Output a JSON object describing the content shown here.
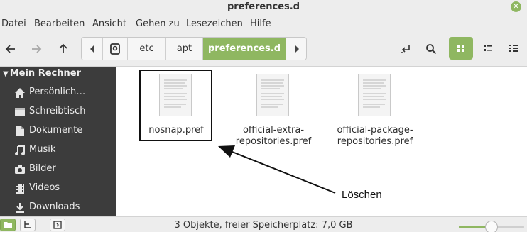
{
  "window": {
    "title": "preferences.d"
  },
  "menu": [
    "Datei",
    "Bearbeiten",
    "Ansicht",
    "Gehen zu",
    "Lesezeichen",
    "Hilfe"
  ],
  "toolbar": {
    "path": [
      "etc",
      "apt",
      "preferences.d"
    ],
    "active_path": "preferences.d"
  },
  "sidebar": {
    "header": "Mein Rechner",
    "items": [
      {
        "label": "Persönlich…",
        "icon": "home-icon"
      },
      {
        "label": "Schreibtisch",
        "icon": "desktop-folder-icon"
      },
      {
        "label": "Dokumente",
        "icon": "document-icon"
      },
      {
        "label": "Musik",
        "icon": "music-icon"
      },
      {
        "label": "Bilder",
        "icon": "camera-icon"
      },
      {
        "label": "Videos",
        "icon": "film-icon"
      },
      {
        "label": "Downloads",
        "icon": "download-icon"
      }
    ]
  },
  "files": [
    {
      "name_lines": [
        "nosnap.pref"
      ],
      "selected": true
    },
    {
      "name_lines": [
        "official-extra-",
        "repositories.pref"
      ],
      "selected": false
    },
    {
      "name_lines": [
        "official-package-",
        "repositories.pref"
      ],
      "selected": false
    }
  ],
  "annotation": {
    "text": "Löschen"
  },
  "status": {
    "text": "3 Objekte, freier Speicherplatz: 7,0 GB",
    "zoom_level": 0.5
  },
  "colors": {
    "accent": "#8fb761",
    "sidebar_bg": "#3c3c3c",
    "chrome_bg": "#ededed"
  }
}
